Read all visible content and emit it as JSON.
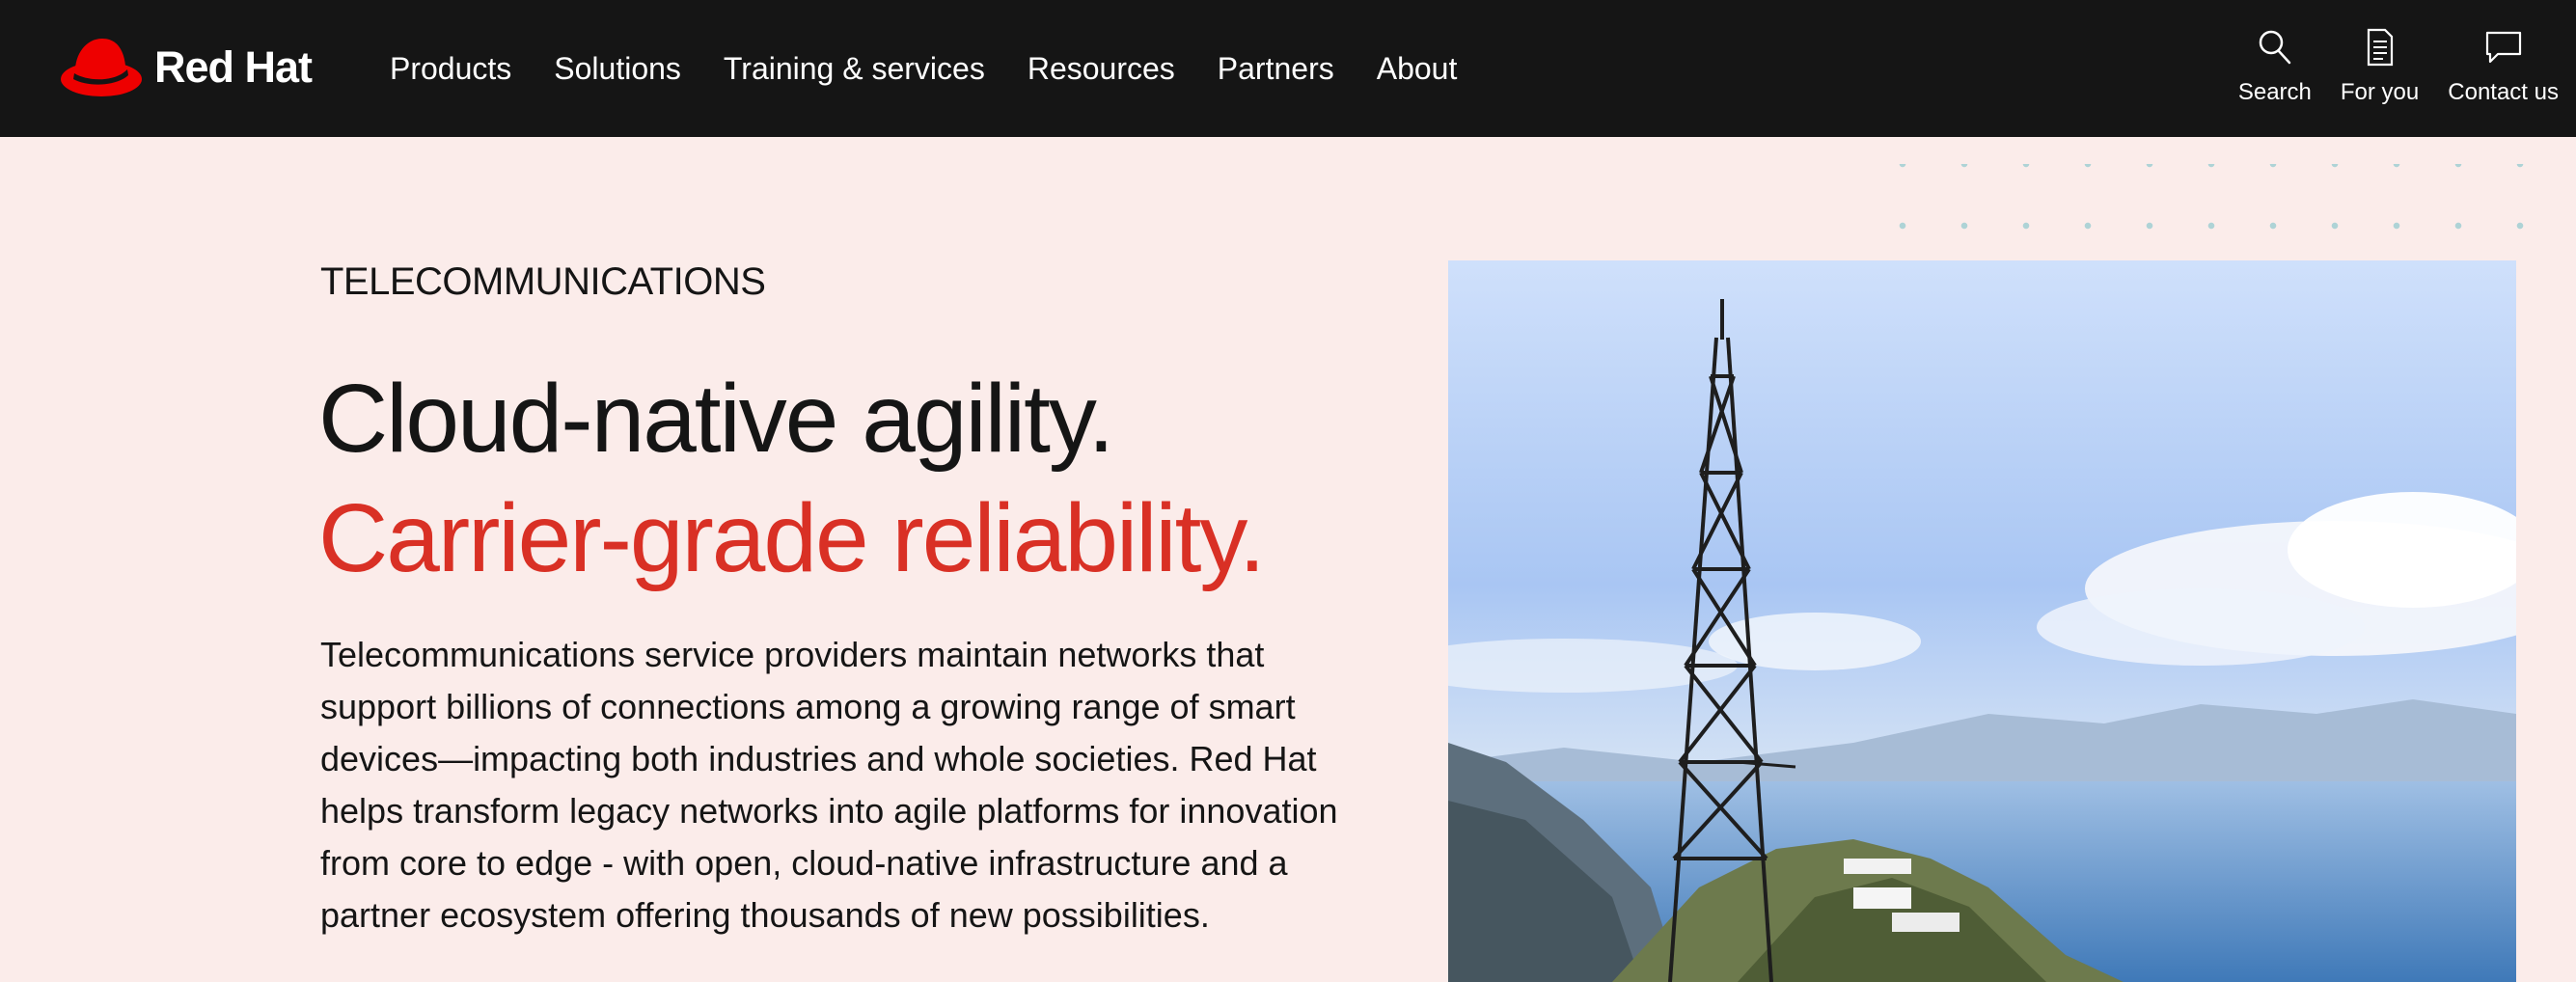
{
  "header": {
    "logo": {
      "text": "Red Hat",
      "icon": "red-hat-fedora-icon",
      "brand_color": "#ee0000"
    },
    "nav": [
      {
        "label": "Products"
      },
      {
        "label": "Solutions"
      },
      {
        "label": "Training & services"
      },
      {
        "label": "Resources"
      },
      {
        "label": "Partners"
      },
      {
        "label": "About"
      }
    ],
    "utility": [
      {
        "label": "Search",
        "icon": "search-icon"
      },
      {
        "label": "For you",
        "icon": "document-icon"
      },
      {
        "label": "Contact us",
        "icon": "chat-bubble-icon"
      }
    ],
    "background": "#151515"
  },
  "hero": {
    "eyebrow": "TELECOMMUNICATIONS",
    "headline_line1": "Cloud-native agility.",
    "headline_line2": "Carrier-grade reliability.",
    "accent_color": "#d93025",
    "body": "Telecommunications service providers maintain networks that support billions of connections among a growing range of smart devices—impacting both industries and whole societies. Red Hat helps transform legacy networks into agile platforms for innovation from core to edge - with open, cloud-native infrastructure and a partner ecosystem offering thousands of new possibilities.",
    "background": "#fbecea",
    "image": "cell-tower-coastline-photo"
  }
}
